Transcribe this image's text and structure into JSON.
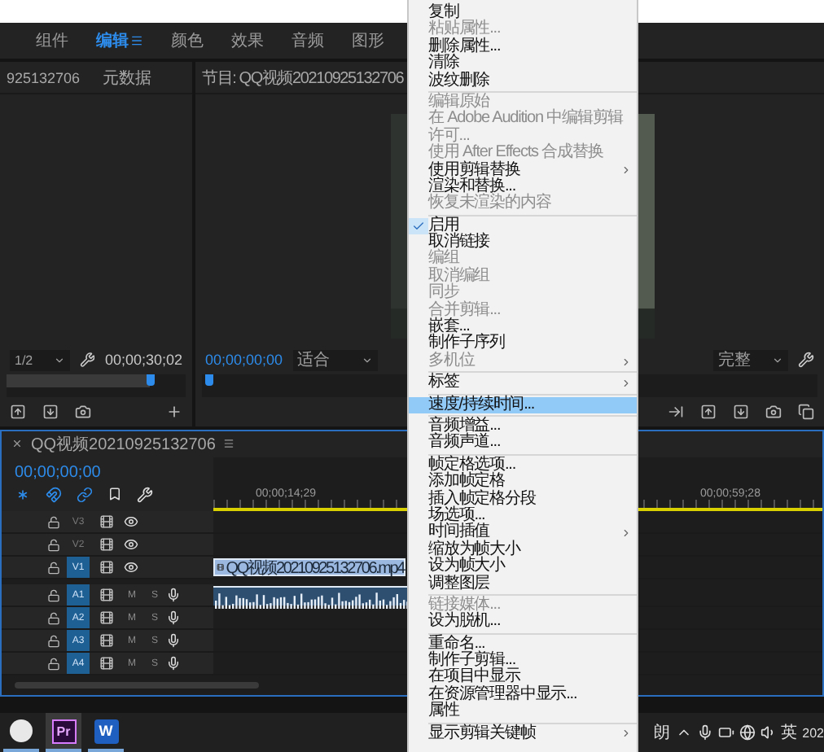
{
  "workspace_tabs": [
    {
      "label": "组件",
      "selected": false
    },
    {
      "label": "编辑",
      "selected": true
    },
    {
      "label": "颜色",
      "selected": false
    },
    {
      "label": "效果",
      "selected": false
    },
    {
      "label": "音频",
      "selected": false
    },
    {
      "label": "图形",
      "selected": false
    }
  ],
  "source_panel": {
    "tabs": [
      "925132706",
      "元数据"
    ],
    "resolution": "1/2",
    "timecode": "00;00;30;02"
  },
  "program_panel": {
    "title": "节目: QQ视频20210925132706",
    "timecode": "00;00;00;00",
    "zoom": "适合",
    "quality": "完整"
  },
  "timeline": {
    "title": "QQ视频20210925132706",
    "timecode": "00;00;00;00",
    "ruler_labels": [
      "00;00;14;29",
      "00;00;59;28"
    ],
    "tracks": [
      {
        "kind": "video",
        "label": "V3",
        "targeted": false
      },
      {
        "kind": "video",
        "label": "V2",
        "targeted": false
      },
      {
        "kind": "video",
        "label": "V1",
        "targeted": true,
        "clip": "QQ视频20210925132706.mp4"
      },
      {
        "kind": "audio",
        "label": "A1",
        "targeted": true,
        "waveform": true,
        "mute": "M",
        "solo": "S"
      },
      {
        "kind": "audio",
        "label": "A2",
        "targeted": true,
        "mute": "M",
        "solo": "S"
      },
      {
        "kind": "audio",
        "label": "A3",
        "targeted": true,
        "mute": "M",
        "solo": "S"
      },
      {
        "kind": "audio",
        "label": "A4",
        "targeted": true,
        "mute": "M",
        "solo": "S"
      }
    ]
  },
  "context_menu": {
    "items": [
      {
        "kind": "item",
        "label": "复制",
        "disabled": false,
        "checked": false,
        "submenu": false,
        "selected": false
      },
      {
        "kind": "item",
        "label": "粘贴属性...",
        "disabled": true,
        "checked": false,
        "submenu": false,
        "selected": false
      },
      {
        "kind": "item",
        "label": "删除属性...",
        "disabled": false,
        "checked": false,
        "submenu": false,
        "selected": false
      },
      {
        "kind": "item",
        "label": "清除",
        "disabled": false,
        "checked": false,
        "submenu": false,
        "selected": false
      },
      {
        "kind": "item",
        "label": "波纹删除",
        "disabled": false,
        "checked": false,
        "submenu": false,
        "selected": false
      },
      {
        "kind": "separator"
      },
      {
        "kind": "item",
        "label": "编辑原始",
        "disabled": true,
        "checked": false,
        "submenu": false,
        "selected": false
      },
      {
        "kind": "item",
        "label": "在 Adobe Audition 中编辑剪辑",
        "disabled": true,
        "checked": false,
        "submenu": false,
        "selected": false
      },
      {
        "kind": "item",
        "label": "许可...",
        "disabled": true,
        "checked": false,
        "submenu": false,
        "selected": false
      },
      {
        "kind": "item",
        "label": "使用 After Effects 合成替换",
        "disabled": true,
        "checked": false,
        "submenu": false,
        "selected": false
      },
      {
        "kind": "item",
        "label": "使用剪辑替换",
        "disabled": false,
        "checked": false,
        "submenu": true,
        "selected": false
      },
      {
        "kind": "item",
        "label": "渲染和替换...",
        "disabled": false,
        "checked": false,
        "submenu": false,
        "selected": false
      },
      {
        "kind": "item",
        "label": "恢复未渲染的内容",
        "disabled": true,
        "checked": false,
        "submenu": false,
        "selected": false
      },
      {
        "kind": "separator"
      },
      {
        "kind": "item",
        "label": "启用",
        "disabled": false,
        "checked": true,
        "submenu": false,
        "selected": false
      },
      {
        "kind": "item",
        "label": "取消链接",
        "disabled": false,
        "checked": false,
        "submenu": false,
        "selected": false
      },
      {
        "kind": "item",
        "label": "编组",
        "disabled": true,
        "checked": false,
        "submenu": false,
        "selected": false
      },
      {
        "kind": "item",
        "label": "取消编组",
        "disabled": true,
        "checked": false,
        "submenu": false,
        "selected": false
      },
      {
        "kind": "item",
        "label": "同步",
        "disabled": true,
        "checked": false,
        "submenu": false,
        "selected": false
      },
      {
        "kind": "item",
        "label": "合并剪辑...",
        "disabled": true,
        "checked": false,
        "submenu": false,
        "selected": false
      },
      {
        "kind": "item",
        "label": "嵌套...",
        "disabled": false,
        "checked": false,
        "submenu": false,
        "selected": false
      },
      {
        "kind": "item",
        "label": "制作子序列",
        "disabled": false,
        "checked": false,
        "submenu": false,
        "selected": false
      },
      {
        "kind": "item",
        "label": "多机位",
        "disabled": true,
        "checked": false,
        "submenu": true,
        "selected": false
      },
      {
        "kind": "separator"
      },
      {
        "kind": "item",
        "label": "标签",
        "disabled": false,
        "checked": false,
        "submenu": true,
        "selected": false
      },
      {
        "kind": "separator"
      },
      {
        "kind": "item",
        "label": "速度/持续时间...",
        "disabled": false,
        "checked": false,
        "submenu": false,
        "selected": true
      },
      {
        "kind": "separator"
      },
      {
        "kind": "item",
        "label": "音频增益...",
        "disabled": false,
        "checked": false,
        "submenu": false,
        "selected": false
      },
      {
        "kind": "item",
        "label": "音频声道...",
        "disabled": false,
        "checked": false,
        "submenu": false,
        "selected": false
      },
      {
        "kind": "separator"
      },
      {
        "kind": "item",
        "label": "帧定格选项...",
        "disabled": false,
        "checked": false,
        "submenu": false,
        "selected": false
      },
      {
        "kind": "item",
        "label": "添加帧定格",
        "disabled": false,
        "checked": false,
        "submenu": false,
        "selected": false
      },
      {
        "kind": "item",
        "label": "插入帧定格分段",
        "disabled": false,
        "checked": false,
        "submenu": false,
        "selected": false
      },
      {
        "kind": "item",
        "label": "场选项...",
        "disabled": false,
        "checked": false,
        "submenu": false,
        "selected": false
      },
      {
        "kind": "item",
        "label": "时间插值",
        "disabled": false,
        "checked": false,
        "submenu": true,
        "selected": false
      },
      {
        "kind": "item",
        "label": "缩放为帧大小",
        "disabled": false,
        "checked": false,
        "submenu": false,
        "selected": false
      },
      {
        "kind": "item",
        "label": "设为帧大小",
        "disabled": false,
        "checked": false,
        "submenu": false,
        "selected": false
      },
      {
        "kind": "item",
        "label": "调整图层",
        "disabled": false,
        "checked": false,
        "submenu": false,
        "selected": false
      },
      {
        "kind": "separator"
      },
      {
        "kind": "item",
        "label": "链接媒体...",
        "disabled": true,
        "checked": false,
        "submenu": false,
        "selected": false
      },
      {
        "kind": "item",
        "label": "设为脱机...",
        "disabled": false,
        "checked": false,
        "submenu": false,
        "selected": false
      },
      {
        "kind": "separator"
      },
      {
        "kind": "item",
        "label": "重命名...",
        "disabled": false,
        "checked": false,
        "submenu": false,
        "selected": false
      },
      {
        "kind": "item",
        "label": "制作子剪辑...",
        "disabled": false,
        "checked": false,
        "submenu": false,
        "selected": false
      },
      {
        "kind": "item",
        "label": "在项目中显示",
        "disabled": false,
        "checked": false,
        "submenu": false,
        "selected": false
      },
      {
        "kind": "item",
        "label": "在资源管理器中显示...",
        "disabled": false,
        "checked": false,
        "submenu": false,
        "selected": false
      },
      {
        "kind": "item",
        "label": "属性",
        "disabled": false,
        "checked": false,
        "submenu": false,
        "selected": false
      },
      {
        "kind": "separator"
      },
      {
        "kind": "item",
        "label": "显示剪辑关键帧",
        "disabled": false,
        "checked": false,
        "submenu": true,
        "selected": false
      }
    ]
  },
  "taskbar": {
    "apps": [
      {
        "kind": "avatar",
        "selected": false
      },
      {
        "kind": "premiere",
        "label": "Pr",
        "selected": true
      },
      {
        "kind": "word",
        "label": "W",
        "selected": false
      }
    ],
    "weather": "朗",
    "language": "英",
    "clock": "202"
  }
}
